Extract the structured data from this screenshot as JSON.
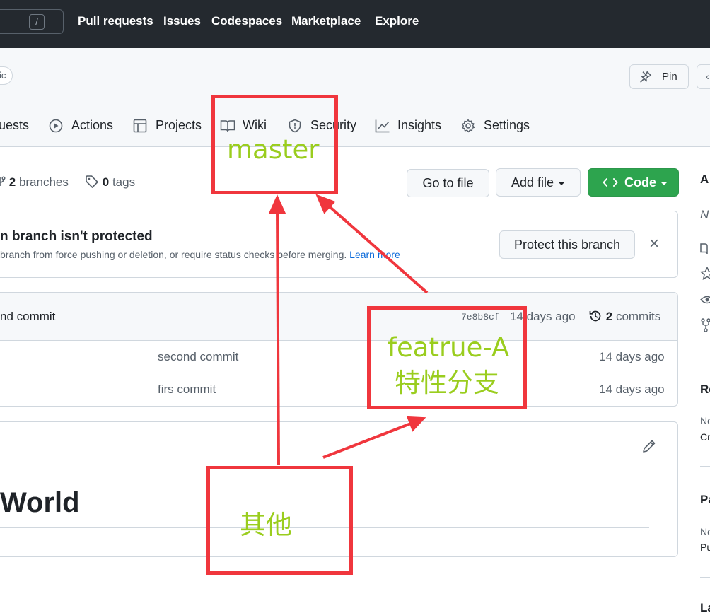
{
  "header": {
    "search_key": "/",
    "nav": [
      "Pull requests",
      "Issues",
      "Codespaces",
      "Marketplace",
      "Explore"
    ]
  },
  "repo": {
    "visibility_fragment": "ic",
    "pin_label": "Pin"
  },
  "tabs": [
    {
      "label": "uests",
      "icon": "pull-request-icon"
    },
    {
      "label": "Actions",
      "icon": "play-icon"
    },
    {
      "label": "Projects",
      "icon": "table-icon"
    },
    {
      "label": "Wiki",
      "icon": "book-icon"
    },
    {
      "label": "Security",
      "icon": "shield-icon"
    },
    {
      "label": "Insights",
      "icon": "graph-icon"
    },
    {
      "label": "Settings",
      "icon": "gear-icon"
    }
  ],
  "branch_meta": {
    "branches_count": "2",
    "branches_label": "branches",
    "tags_count": "0",
    "tags_label": "tags"
  },
  "buttons": {
    "go_to_file": "Go to file",
    "add_file": "Add file",
    "code": "Code"
  },
  "protect": {
    "title": "n branch isn't protected",
    "description": "branch from force pushing or deletion, or require status checks before merging.",
    "link": "Learn more",
    "button": "Protect this branch",
    "close": "×"
  },
  "commit_bar": {
    "message": "nd commit",
    "sha": "7e8b8cf",
    "time": "14 days ago",
    "commits_count": "2",
    "commits_label": "commits"
  },
  "files": [
    {
      "message": "second commit",
      "time": "14 days ago"
    },
    {
      "message": "firs commit",
      "time": "14 days ago"
    }
  ],
  "readme": {
    "heading": "World"
  },
  "sidebar": {
    "about_fragment": "A",
    "desc_fragment": "N",
    "releases_fragment": "Re",
    "releases_none": "No",
    "releases_create": "Cr",
    "packages_fragment": "Pa",
    "packages_none": "No",
    "packages_publish": "Pu",
    "languages_fragment": "La"
  },
  "annotations": {
    "master": "master",
    "feature_line1": "featrue-A",
    "feature_line2": "特性分支",
    "other": "其他",
    "box_color": "#f0363d",
    "text_color": "#9acd1e"
  },
  "colors": {
    "header_bg": "#24292f",
    "accent_green": "#2da44e",
    "link_blue": "#0969da"
  }
}
